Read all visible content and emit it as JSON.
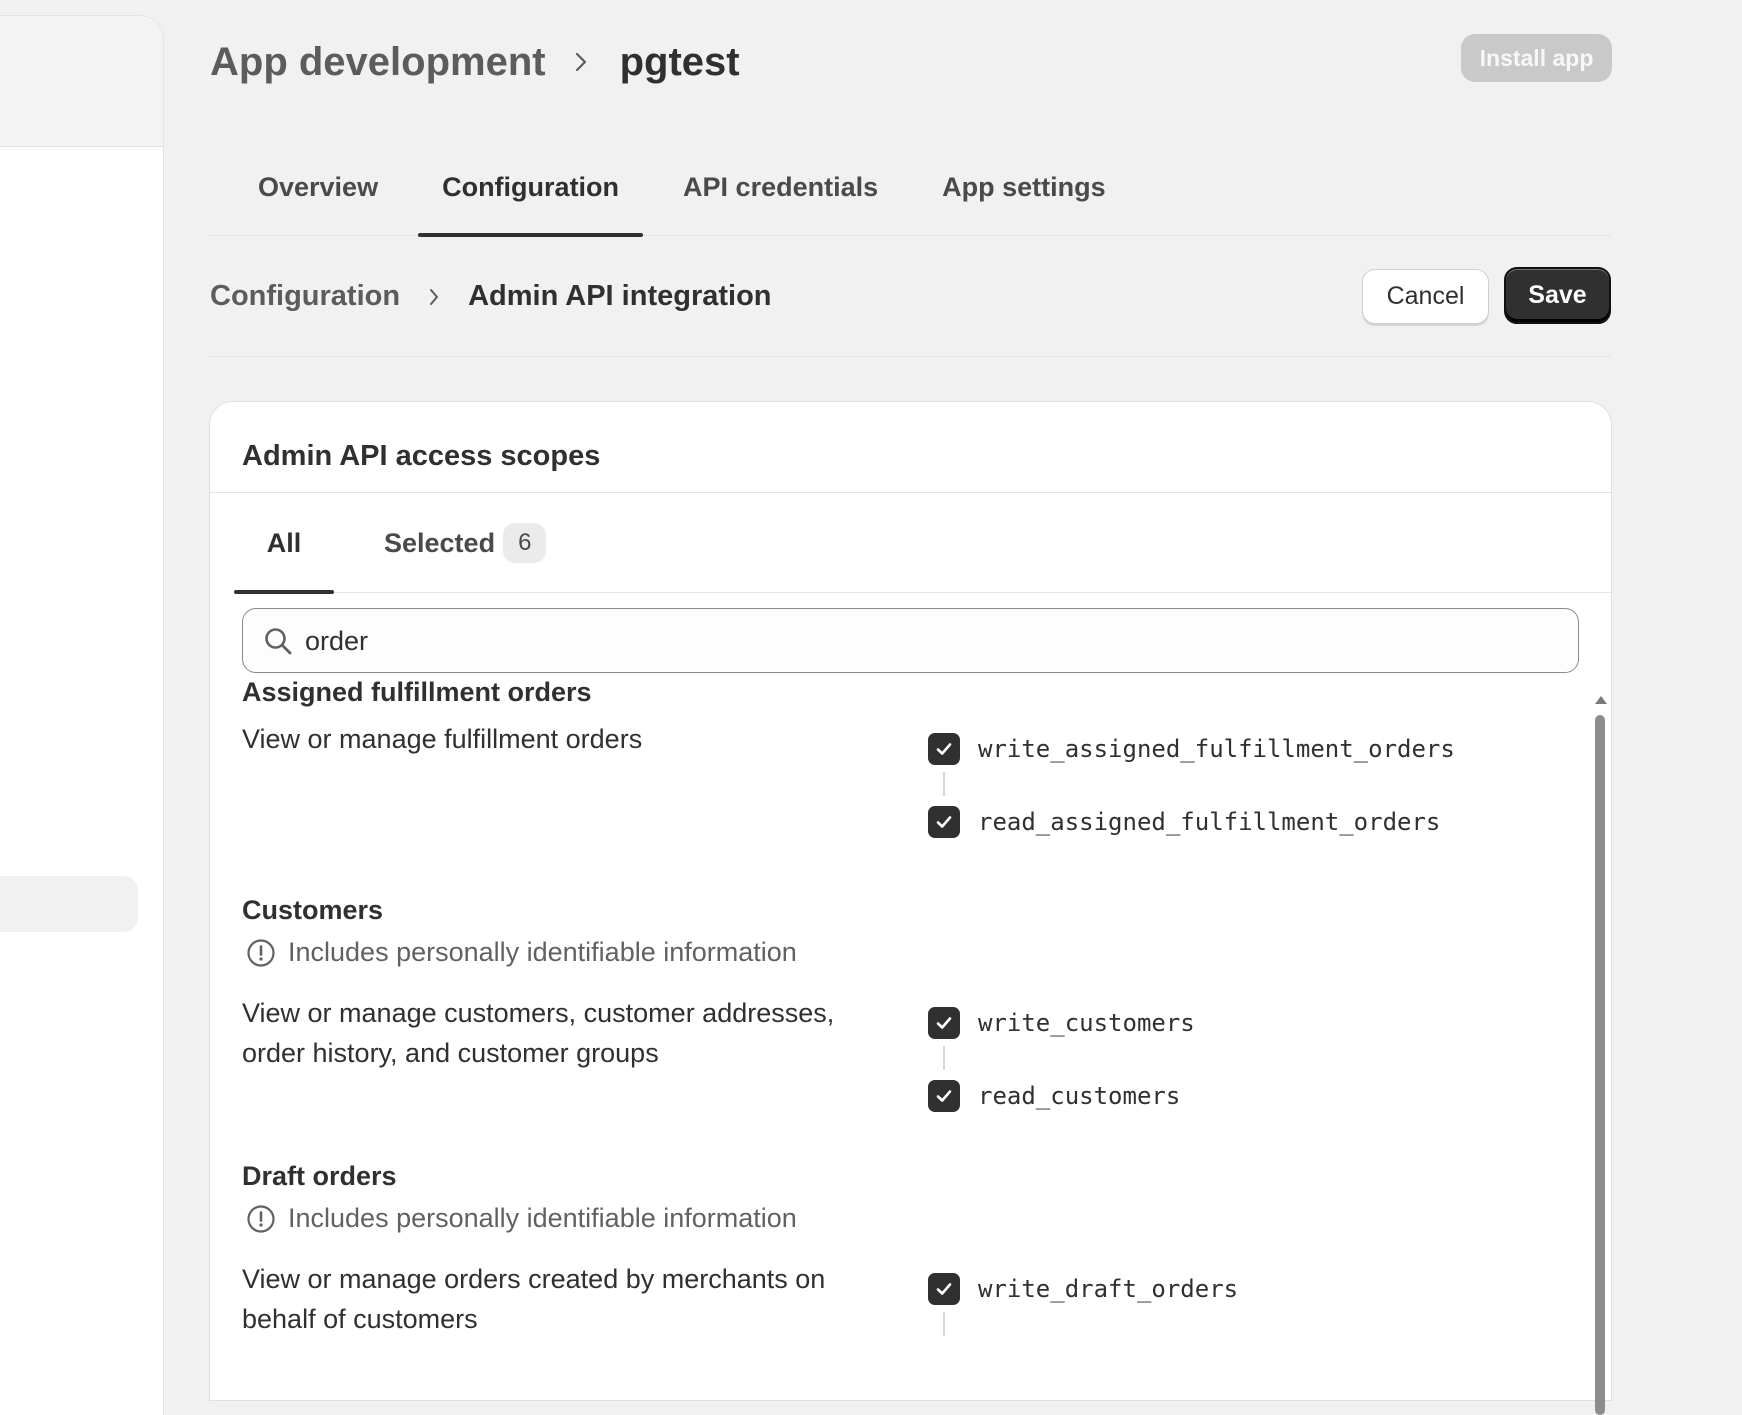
{
  "header": {
    "breadcrumb_parent": "App development",
    "breadcrumb_current": "pgtest",
    "install_label": "Install app"
  },
  "tabs": [
    {
      "label": "Overview"
    },
    {
      "label": "Configuration"
    },
    {
      "label": "API credentials"
    },
    {
      "label": "App settings"
    }
  ],
  "subheader": {
    "breadcrumb_parent": "Configuration",
    "breadcrumb_current": "Admin API integration",
    "cancel_label": "Cancel",
    "save_label": "Save"
  },
  "card": {
    "title": "Admin API access scopes",
    "tab_all": "All",
    "tab_selected": "Selected",
    "selected_count": "6"
  },
  "search": {
    "value": "order"
  },
  "groups": [
    {
      "title": "Assigned fulfillment orders",
      "pii": "",
      "description": "View or manage fulfillment orders",
      "scopes": [
        "write_assigned_fulfillment_orders",
        "read_assigned_fulfillment_orders"
      ]
    },
    {
      "title": "Customers",
      "pii": "Includes personally identifiable information",
      "description": "View or manage customers, customer addresses, order history, and customer groups",
      "scopes": [
        "write_customers",
        "read_customers"
      ]
    },
    {
      "title": "Draft orders",
      "pii": "Includes personally identifiable information",
      "description": "View or manage orders created by merchants on behalf of customers",
      "scopes": [
        "write_draft_orders"
      ]
    }
  ],
  "icons": {
    "breadcrumb_separator": "chevron-right-icon",
    "search": "search-icon",
    "pii": "alert-circle-icon",
    "checkbox": "checkmark-icon"
  },
  "colors": {
    "primary_button": "#303030",
    "disabled_button": "#c9c9c9",
    "background": "#f1f1f1"
  }
}
